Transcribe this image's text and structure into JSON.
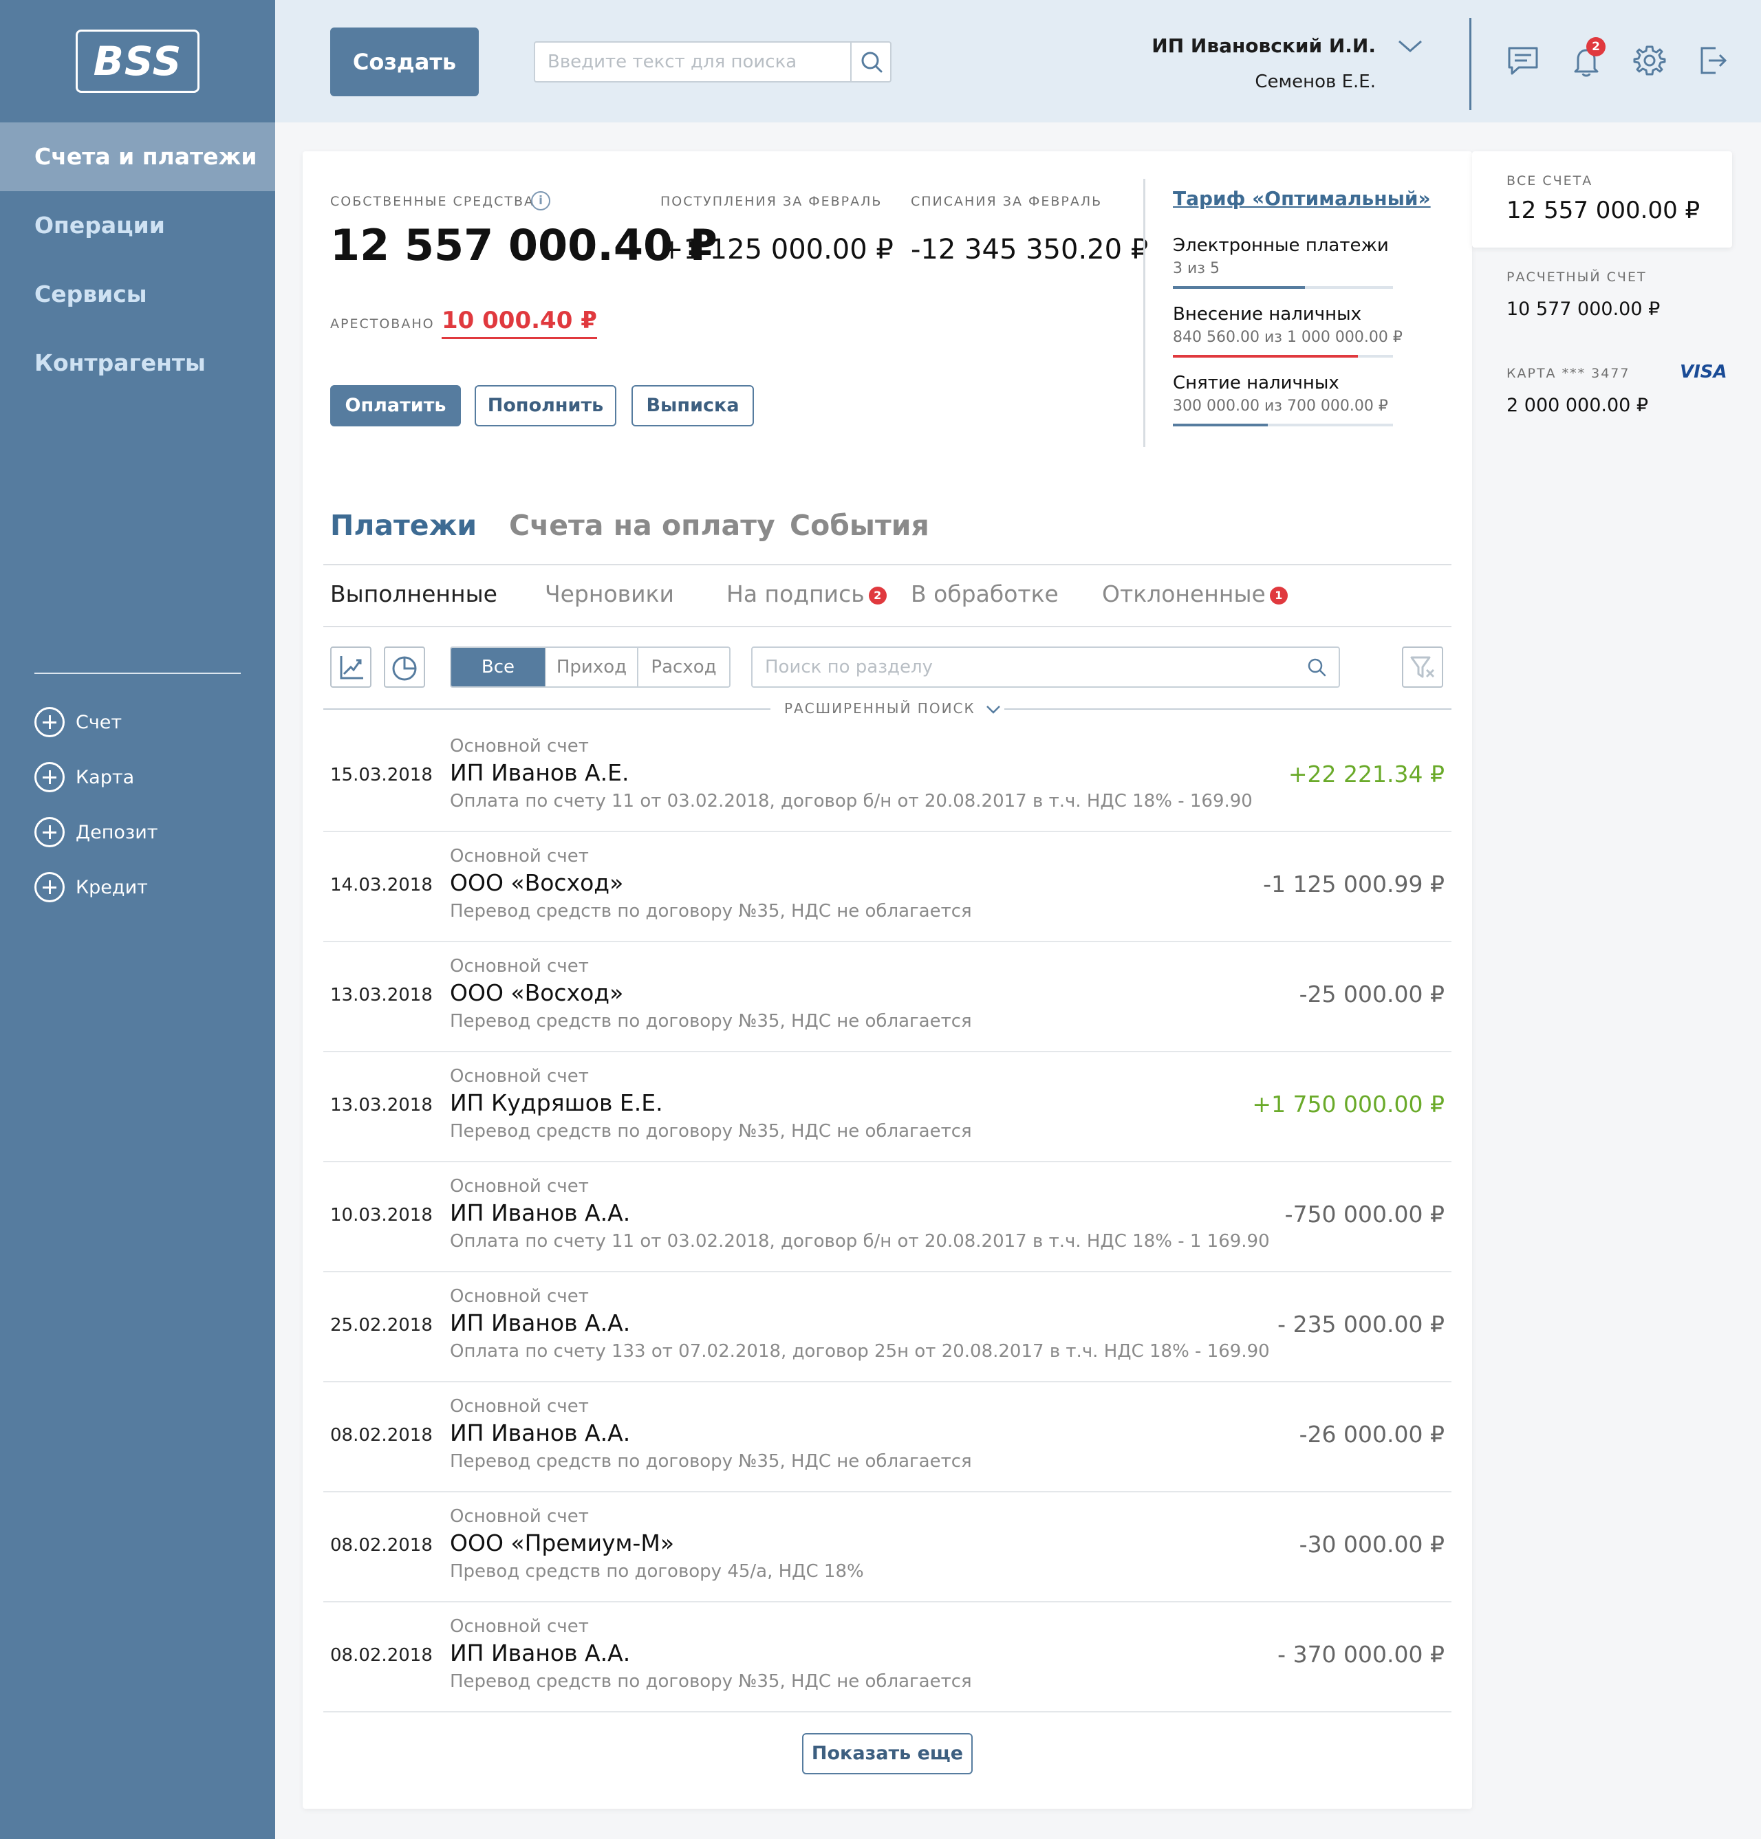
{
  "sidebar": {
    "logo": "BSS",
    "nav": [
      "Счета и платежи",
      "Операции",
      "Сервисы",
      "Контрагенты"
    ],
    "add_items": [
      "Счет",
      "Карта",
      "Депозит",
      "Кредит"
    ]
  },
  "header": {
    "create_label": "Создать",
    "search_placeholder": "Введите текст для поиска",
    "user_name": "ИП Ивановский И.И.",
    "user_sub": "Семенов Е.Е.",
    "notifications_count": "2"
  },
  "summary": {
    "own_funds_label": "СОБСТВЕННЫЕ СРЕДСТВА",
    "own_funds_value": "12 557 000.40 ₽",
    "income_label": "ПОСТУПЛЕНИЯ ЗА ФЕВРАЛЬ",
    "income_value": "+1 125 000.00 ₽",
    "expense_label": "СПИСАНИЯ ЗА ФЕВРАЛЬ",
    "expense_value": "-12 345 350.20 ₽",
    "arrested_label": "АРЕСТОВАНО",
    "arrested_value": "10 000.40 ₽",
    "buttons": {
      "pay": "Оплатить",
      "topup": "Пополнить",
      "statement": "Выписка"
    }
  },
  "tariff": {
    "link": "Тариф «Оптимальный»",
    "limits": [
      {
        "title": "Электронные платежи",
        "sub": "3 из 5",
        "fraction": 0.6,
        "color": "#567c9f"
      },
      {
        "title": "Внесение наличных",
        "sub": "840 560.00 из 1 000 000.00 ₽",
        "fraction": 0.84,
        "color": "#e0393e"
      },
      {
        "title": "Снятие наличных",
        "sub": "300 000.00 из 700 000.00 ₽",
        "fraction": 0.43,
        "color": "#567c9f"
      }
    ]
  },
  "tabs": {
    "main": [
      "Платежи",
      "Счета на оплату",
      "События"
    ],
    "sub": [
      {
        "label": "Выполненные",
        "badge": ""
      },
      {
        "label": "Черновики",
        "badge": ""
      },
      {
        "label": "На подпись",
        "badge": "2"
      },
      {
        "label": "В обработке",
        "badge": ""
      },
      {
        "label": "Отклоненные",
        "badge": "1"
      }
    ]
  },
  "filters": {
    "segments": [
      "Все",
      "Приход",
      "Расход"
    ],
    "search_placeholder": "Поиск по разделу",
    "advanced": "РАСШИРЕННЫЙ ПОИСК"
  },
  "payments": [
    {
      "date": "15.03.2018",
      "account": "Основной счет",
      "party": "ИП Иванов А.Е.",
      "desc": "Оплата по счету 11 от 03.02.2018, договор б/н от 20.08.2017 в т.ч. НДС 18% - 169.90",
      "amount": "+22 221.34 ₽",
      "incoming": true
    },
    {
      "date": "14.03.2018",
      "account": "Основной счет",
      "party": "ООО «Восход»",
      "desc": "Перевод средств по договору №35, НДС не облагается",
      "amount": "-1 125 000.99 ₽",
      "incoming": false
    },
    {
      "date": "13.03.2018",
      "account": "Основной счет",
      "party": "ООО «Восход»",
      "desc": "Перевод средств по договору №35, НДС не облагается",
      "amount": "-25 000.00 ₽",
      "incoming": false
    },
    {
      "date": "13.03.2018",
      "account": "Основной счет",
      "party": "ИП Кудряшов Е.Е.",
      "desc": "Перевод средств по договору №35, НДС не облагается",
      "amount": "+1 750 000.00 ₽",
      "incoming": true
    },
    {
      "date": "10.03.2018",
      "account": "Основной счет",
      "party": "ИП Иванов А.А.",
      "desc": "Оплата по счету 11 от 03.02.2018, договор б/н от 20.08.2017 в т.ч. НДС 18% - 1 169.90",
      "amount": "-750 000.00 ₽",
      "incoming": false
    },
    {
      "date": "25.02.2018",
      "account": "Основной счет",
      "party": "ИП Иванов А.А.",
      "desc": "Оплата по счету 133 от 07.02.2018, договор 25н от 20.08.2017 в т.ч. НДС 18% - 169.90",
      "amount": "- 235 000.00 ₽",
      "incoming": false
    },
    {
      "date": "08.02.2018",
      "account": "Основной счет",
      "party": "ИП Иванов А.А.",
      "desc": "Перевод средств по договору №35, НДС не облагается",
      "amount": "-26 000.00 ₽",
      "incoming": false
    },
    {
      "date": "08.02.2018",
      "account": "Основной счет",
      "party": "ООО «Премиум-М»",
      "desc": "Превод средств по договору 45/а, НДС 18%",
      "amount": "-30 000.00 ₽",
      "incoming": false
    },
    {
      "date": "08.02.2018",
      "account": "Основной счет",
      "party": "ИП Иванов А.А.",
      "desc": "Перевод средств по договору №35, НДС не облагается",
      "amount": "- 370 000.00 ₽",
      "incoming": false
    }
  ],
  "show_more": "Показать еще",
  "accounts": {
    "all_label": "ВСЕ СЧЕТА",
    "all_value": "12 557 000.00 ₽",
    "current_label": "РАСЧЕТНЫЙ СЧЕТ",
    "current_value": "10 577 000.00 ₽",
    "card_label": "КАРТА *** 3477",
    "card_brand": "VISA",
    "card_value": "2 000 000.00 ₽"
  },
  "colors": {
    "brand": "#567c9f",
    "income": "#6aaa2a",
    "alert": "#e0393e"
  }
}
